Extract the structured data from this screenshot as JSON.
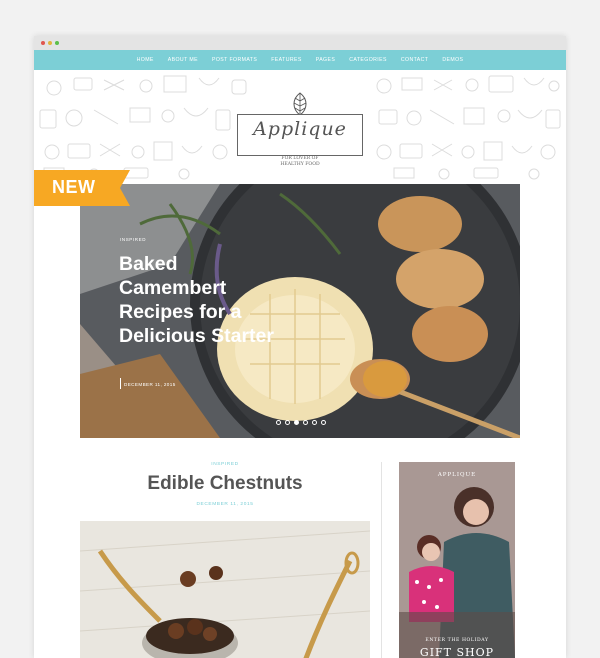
{
  "nav": {
    "items": [
      "Home",
      "About Me",
      "Post Formats",
      "Features",
      "Pages",
      "Categories",
      "Contact",
      "Demos"
    ]
  },
  "logo": {
    "name": "Applique",
    "tagline_1": "For lover of",
    "tagline_2": "healthy food"
  },
  "ribbon": {
    "label": "NEW",
    "color": "#f7a823"
  },
  "hero": {
    "category": "Inspired",
    "title": "Baked Camembert Recipes for a Delicious Starter",
    "date": "December 11, 2015",
    "slides": 6,
    "active_slide": 3
  },
  "post": {
    "category": "Inspired",
    "title": "Edible Chestnuts",
    "date": "December 11, 2015"
  },
  "ad": {
    "brand": "APPLIQUE",
    "enter_text": "ENTER THE HOLIDAY",
    "headline": "GIFT SHOP"
  },
  "colors": {
    "accent": "#7ccfd6",
    "ribbon": "#f7a823",
    "text": "#555555"
  }
}
